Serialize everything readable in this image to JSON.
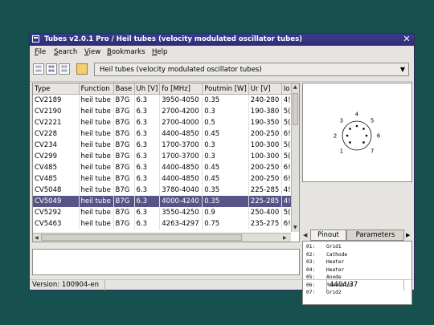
{
  "window": {
    "title": "Tubes v2.0.1 Pro / Heil tubes (velocity modulated oscillator tubes)"
  },
  "menu": [
    {
      "label": "File",
      "key": "F",
      "rest": "ile"
    },
    {
      "label": "Search",
      "key": "S",
      "rest": "earch"
    },
    {
      "label": "View",
      "key": "V",
      "rest": "iew"
    },
    {
      "label": "Bookmarks",
      "key": "B",
      "rest": "ookmarks"
    },
    {
      "label": "Help",
      "key": "H",
      "rest": "elp"
    }
  ],
  "toolbar": {
    "category": "Heil tubes (velocity modulated oscillator tubes)"
  },
  "table": {
    "columns": [
      "Type",
      "Function",
      "Base",
      "Uh [V]",
      "fo [MHz]",
      "Poutmin [W]",
      "Ur [V]",
      "Io"
    ],
    "rows": [
      [
        "CV2189",
        "heil tube",
        "B7G",
        "6.3",
        "3950-4050",
        "0.35",
        "240-280",
        "4!"
      ],
      [
        "CV2190",
        "heil tube",
        "B7G",
        "6.3",
        "2700-4200",
        "0.3",
        "190-380",
        "5("
      ],
      [
        "CV2221",
        "heil tube",
        "B7G",
        "6.3",
        "2700-4000",
        "0.5",
        "190-350",
        "5("
      ],
      [
        "CV228",
        "heil tube",
        "B7G",
        "6.3",
        "4400-4850",
        "0.45",
        "200-250",
        "6!"
      ],
      [
        "CV234",
        "heil tube",
        "B7G",
        "6.3",
        "1700-3700",
        "0.3",
        "100-300",
        "5("
      ],
      [
        "CV299",
        "heil tube",
        "B7G",
        "6.3",
        "1700-3700",
        "0.3",
        "100-300",
        "5("
      ],
      [
        "CV485",
        "heil tube",
        "B7G",
        "6.3",
        "4400-4850",
        "0.45",
        "200-250",
        "6!"
      ],
      [
        "CV485",
        "heil tube",
        "B7G",
        "6.3",
        "4400-4850",
        "0.45",
        "200-250",
        "6!"
      ],
      [
        "CV5048",
        "heil tube",
        "B7G",
        "6.3",
        "3780-4040",
        "0.35",
        "225-285",
        "4!"
      ],
      [
        "CV5049",
        "heil tube",
        "B7G",
        "6.3",
        "4000-4240",
        "0.35",
        "225-285",
        "4!"
      ],
      [
        "CV5292",
        "heil tube",
        "B7G",
        "6.3",
        "3550-4250",
        "0.9",
        "250-400",
        "5("
      ],
      [
        "CV5463",
        "heil tube",
        "B7G",
        "6.3",
        "4263-4297",
        "0.75",
        "235-275",
        "6!"
      ]
    ],
    "selected_row": 9
  },
  "diagram": {
    "pins": [
      {
        "label": "1"
      },
      {
        "label": "2"
      },
      {
        "label": "3"
      },
      {
        "label": "4"
      },
      {
        "label": "5"
      },
      {
        "label": "6"
      },
      {
        "label": "7"
      }
    ]
  },
  "tabs": {
    "pinout": "Pinout",
    "parameters": "Parameters",
    "active": "pinout"
  },
  "pinout": [
    {
      "num": "01:",
      "name": "Grid1"
    },
    {
      "num": "02:",
      "name": "Cathode"
    },
    {
      "num": "03:",
      "name": "Heater"
    },
    {
      "num": "04:",
      "name": "Heater"
    },
    {
      "num": "05:",
      "name": "Anode"
    },
    {
      "num": "06:",
      "name": "Resonator"
    },
    {
      "num": "07:",
      "name": "Grid2"
    }
  ],
  "status": {
    "version": "Version: 100904-en",
    "count": "4404/37"
  },
  "colors": {
    "desktop": "#17514f",
    "titlebar": "#2f2d78",
    "selection": "#575488"
  }
}
